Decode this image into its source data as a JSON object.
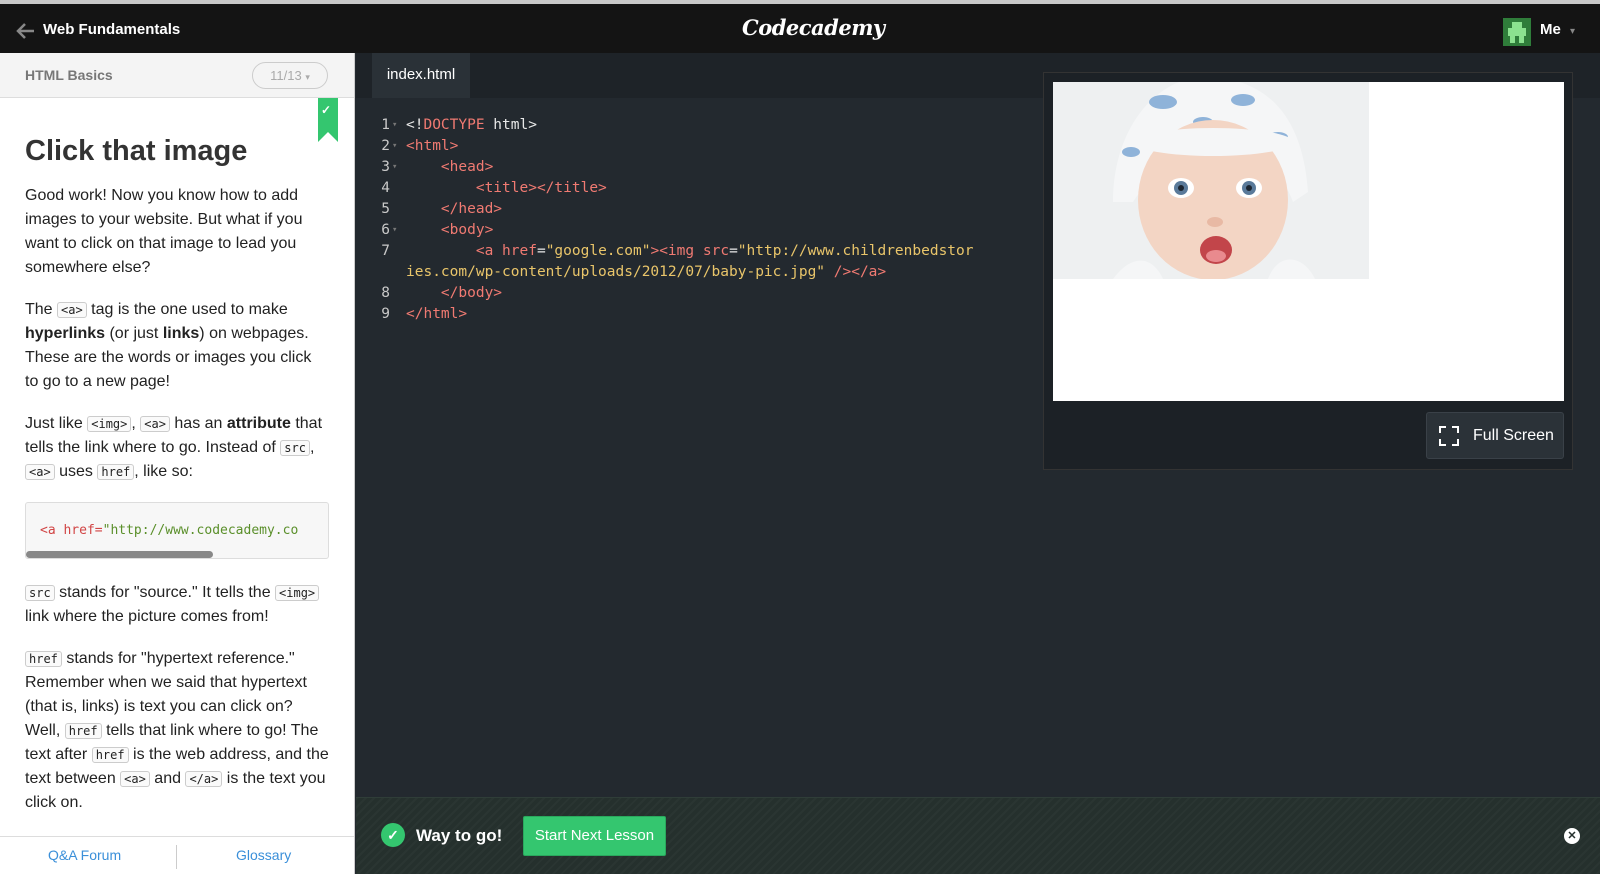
{
  "header": {
    "course_title": "Web Fundamentals",
    "logo_text": "Codecademy",
    "user_label": "Me",
    "icons": {
      "back": "arrow-left-icon",
      "caret": "chevron-down-icon"
    }
  },
  "lesson_panel": {
    "section_title": "HTML Basics",
    "progress": "11/13",
    "exercise_title": "Click that image",
    "p1": "Good work! Now you know how to add images to your website. But what if you want to click on that image to lead you somewhere else?",
    "p2": {
      "a": "The ",
      "code_a": "<a>",
      "b": " tag is the one used to make ",
      "bold1": "hyperlinks",
      "c": " (or just ",
      "bold2": "links",
      "d": ") on webpages. These are the words or images you click to go to a new page!"
    },
    "p3": {
      "a": "Just like ",
      "code_img": "<img>",
      "comma": ", ",
      "code_a": "<a>",
      "b": " has an ",
      "bold": "attribute",
      "c": " that tells the link where to go. Instead of ",
      "code_src": "src",
      "d": ", ",
      "code_a2": "<a>",
      "e": " uses ",
      "code_href": "href",
      "f": ", like so:"
    },
    "code_example": {
      "tag": "<a href=",
      "value": "\"http://www.codecademy.co"
    },
    "p4": {
      "code_src": "src",
      "a": " stands for \"source.\" It tells the ",
      "code_img": "<img>",
      "b": " link where the picture comes from!"
    },
    "p5": {
      "code_href": "href",
      "a": " stands for \"hypertext reference.\" Remember when we said that hypertext (that is, links) is text you can click on? Well, ",
      "code_href2": "href",
      "b": " tells that link where to go! The text after ",
      "code_href3": "href",
      "c": " is the web address, and the text between ",
      "code_a_open": "<a>",
      "d": " and ",
      "code_a_close": "</a>",
      "e": " is the text you click on."
    },
    "footer": {
      "qa": "Q&A Forum",
      "glossary": "Glossary"
    }
  },
  "editor": {
    "tab": "index.html",
    "lines": [
      {
        "n": "1",
        "fold": true
      },
      {
        "n": "2",
        "fold": true
      },
      {
        "n": "3",
        "fold": true
      },
      {
        "n": "4",
        "fold": false
      },
      {
        "n": "5",
        "fold": false
      },
      {
        "n": "6",
        "fold": true
      },
      {
        "n": "7",
        "fold": false
      },
      {
        "n": "",
        "fold": false
      },
      {
        "n": "8",
        "fold": false
      },
      {
        "n": "9",
        "fold": false
      }
    ],
    "code": {
      "l1a": "<!",
      "l1b": "DOCTYPE",
      "l1c": " html>",
      "l2": "<html>",
      "l3": "<head>",
      "l4": "<title></title>",
      "l5": "</head>",
      "l6": "<body>",
      "l7a": "<a ",
      "l7b": "href",
      "l7c": "=",
      "l7d": "\"google.com\"",
      "l7e": "><img ",
      "l7f": "src",
      "l7g": "=",
      "l7h": "\"http://www.childrenbedstor",
      "l7i": "ies.com/wp-content/uploads/2012/07/baby-pic.jpg\"",
      "l7j": " /></a>",
      "l8": "</body>",
      "l9": "</html>"
    }
  },
  "preview": {
    "fullscreen_label": "Full Screen",
    "image_icon": "baby-photo"
  },
  "bottom_bar": {
    "message": "Way to go!",
    "next_button": "Start Next Lesson",
    "icons": {
      "check": "check-circle-icon",
      "close": "close-icon"
    }
  }
}
